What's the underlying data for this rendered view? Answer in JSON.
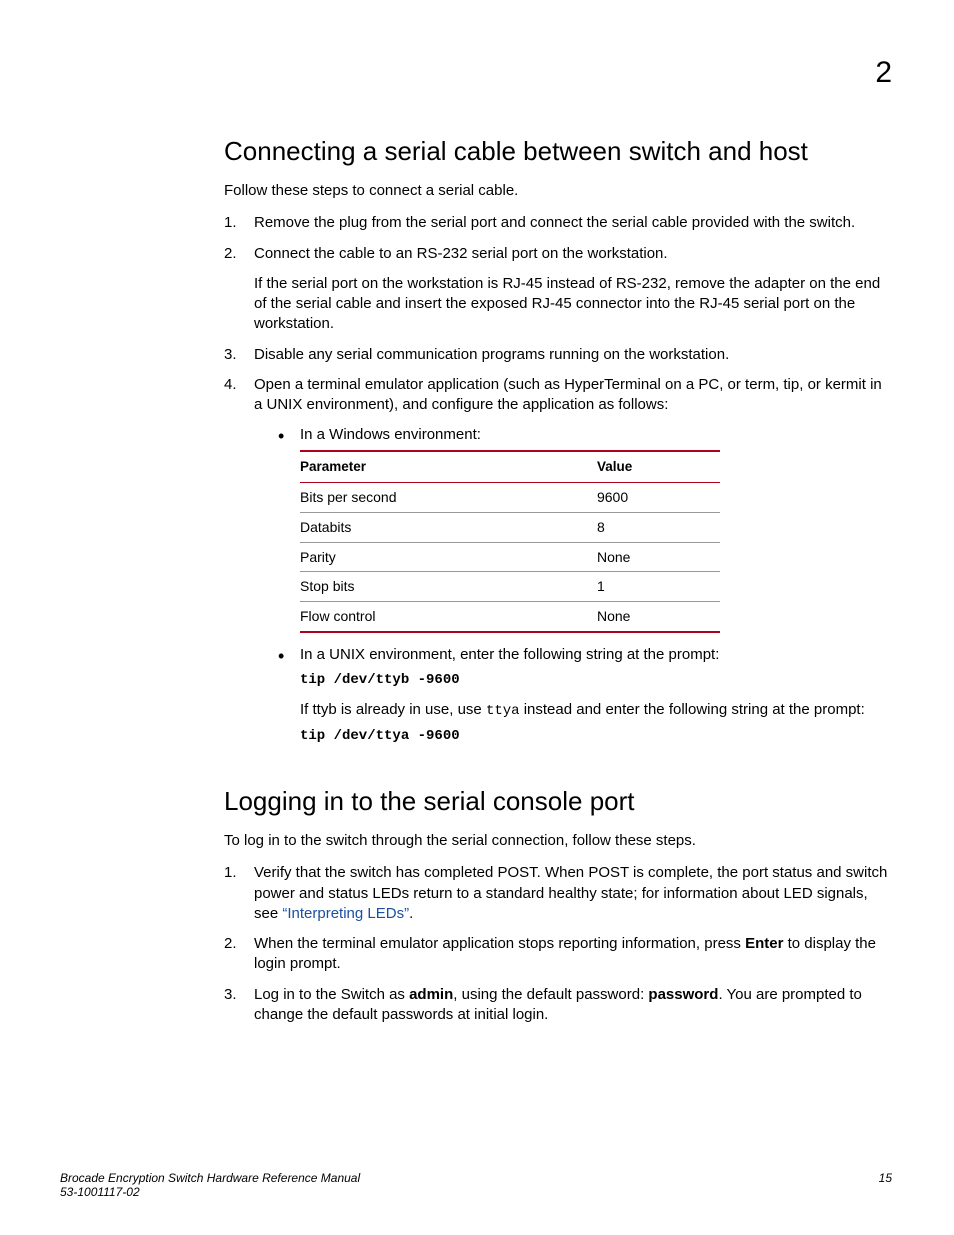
{
  "chapter_number": "2",
  "section1": {
    "title": "Connecting a serial cable between switch and host",
    "intro": "Follow these steps to connect a serial cable.",
    "steps": {
      "s1": "Remove the plug from the serial port and connect the serial cable provided with the switch.",
      "s2": "Connect the cable to an RS-232 serial port on the workstation.",
      "s2_note": "If the serial port on the workstation is RJ-45 instead of RS-232, remove the adapter on the end of the serial cable and insert the exposed RJ-45 connector into the RJ-45 serial port on the workstation.",
      "s3": "Disable any serial communication programs running on the workstation.",
      "s4": "Open a terminal emulator application (such as HyperTerminal on a PC, or term, tip, or kermit in a UNIX environment), and configure the application as follows:",
      "bullet_win": "In a Windows environment:",
      "table": {
        "hdr_param": "Parameter",
        "hdr_value": "Value",
        "rows": [
          {
            "p": "Bits per second",
            "v": "9600"
          },
          {
            "p": "Databits",
            "v": "8"
          },
          {
            "p": "Parity",
            "v": "None"
          },
          {
            "p": "Stop bits",
            "v": "1"
          },
          {
            "p": "Flow control",
            "v": "None"
          }
        ]
      },
      "bullet_unix": "In a UNIX environment, enter the following string at the prompt:",
      "cmd1": "tip /dev/ttyb -9600",
      "unix_note_pre": "If ttyb is already in use, use ",
      "unix_note_mono": "ttya",
      "unix_note_post": " instead and enter the following string at the prompt:",
      "cmd2": "tip /dev/ttya -9600"
    }
  },
  "section2": {
    "title": "Logging in to the serial console port",
    "intro": "To log in to the switch through the serial connection, follow these steps.",
    "steps": {
      "s1_pre": "Verify that the switch has completed POST. When POST is complete, the port status and switch power and status LEDs return to a standard healthy state; for information about LED signals, see ",
      "s1_link": "“Interpreting LEDs”",
      "s1_post": ".",
      "s2_pre": "When the terminal emulator application stops reporting information, press ",
      "s2_bold": "Enter",
      "s2_post": " to display the login prompt.",
      "s3_pre": "Log in to the Switch as ",
      "s3_b1": "admin",
      "s3_mid": ", using the default password: ",
      "s3_b2": "password",
      "s3_post": ". You are prompted to change the default passwords at initial login."
    }
  },
  "footer": {
    "title": "Brocade Encryption Switch Hardware Reference Manual",
    "docnum": "53-1001117-02",
    "page": "15"
  }
}
